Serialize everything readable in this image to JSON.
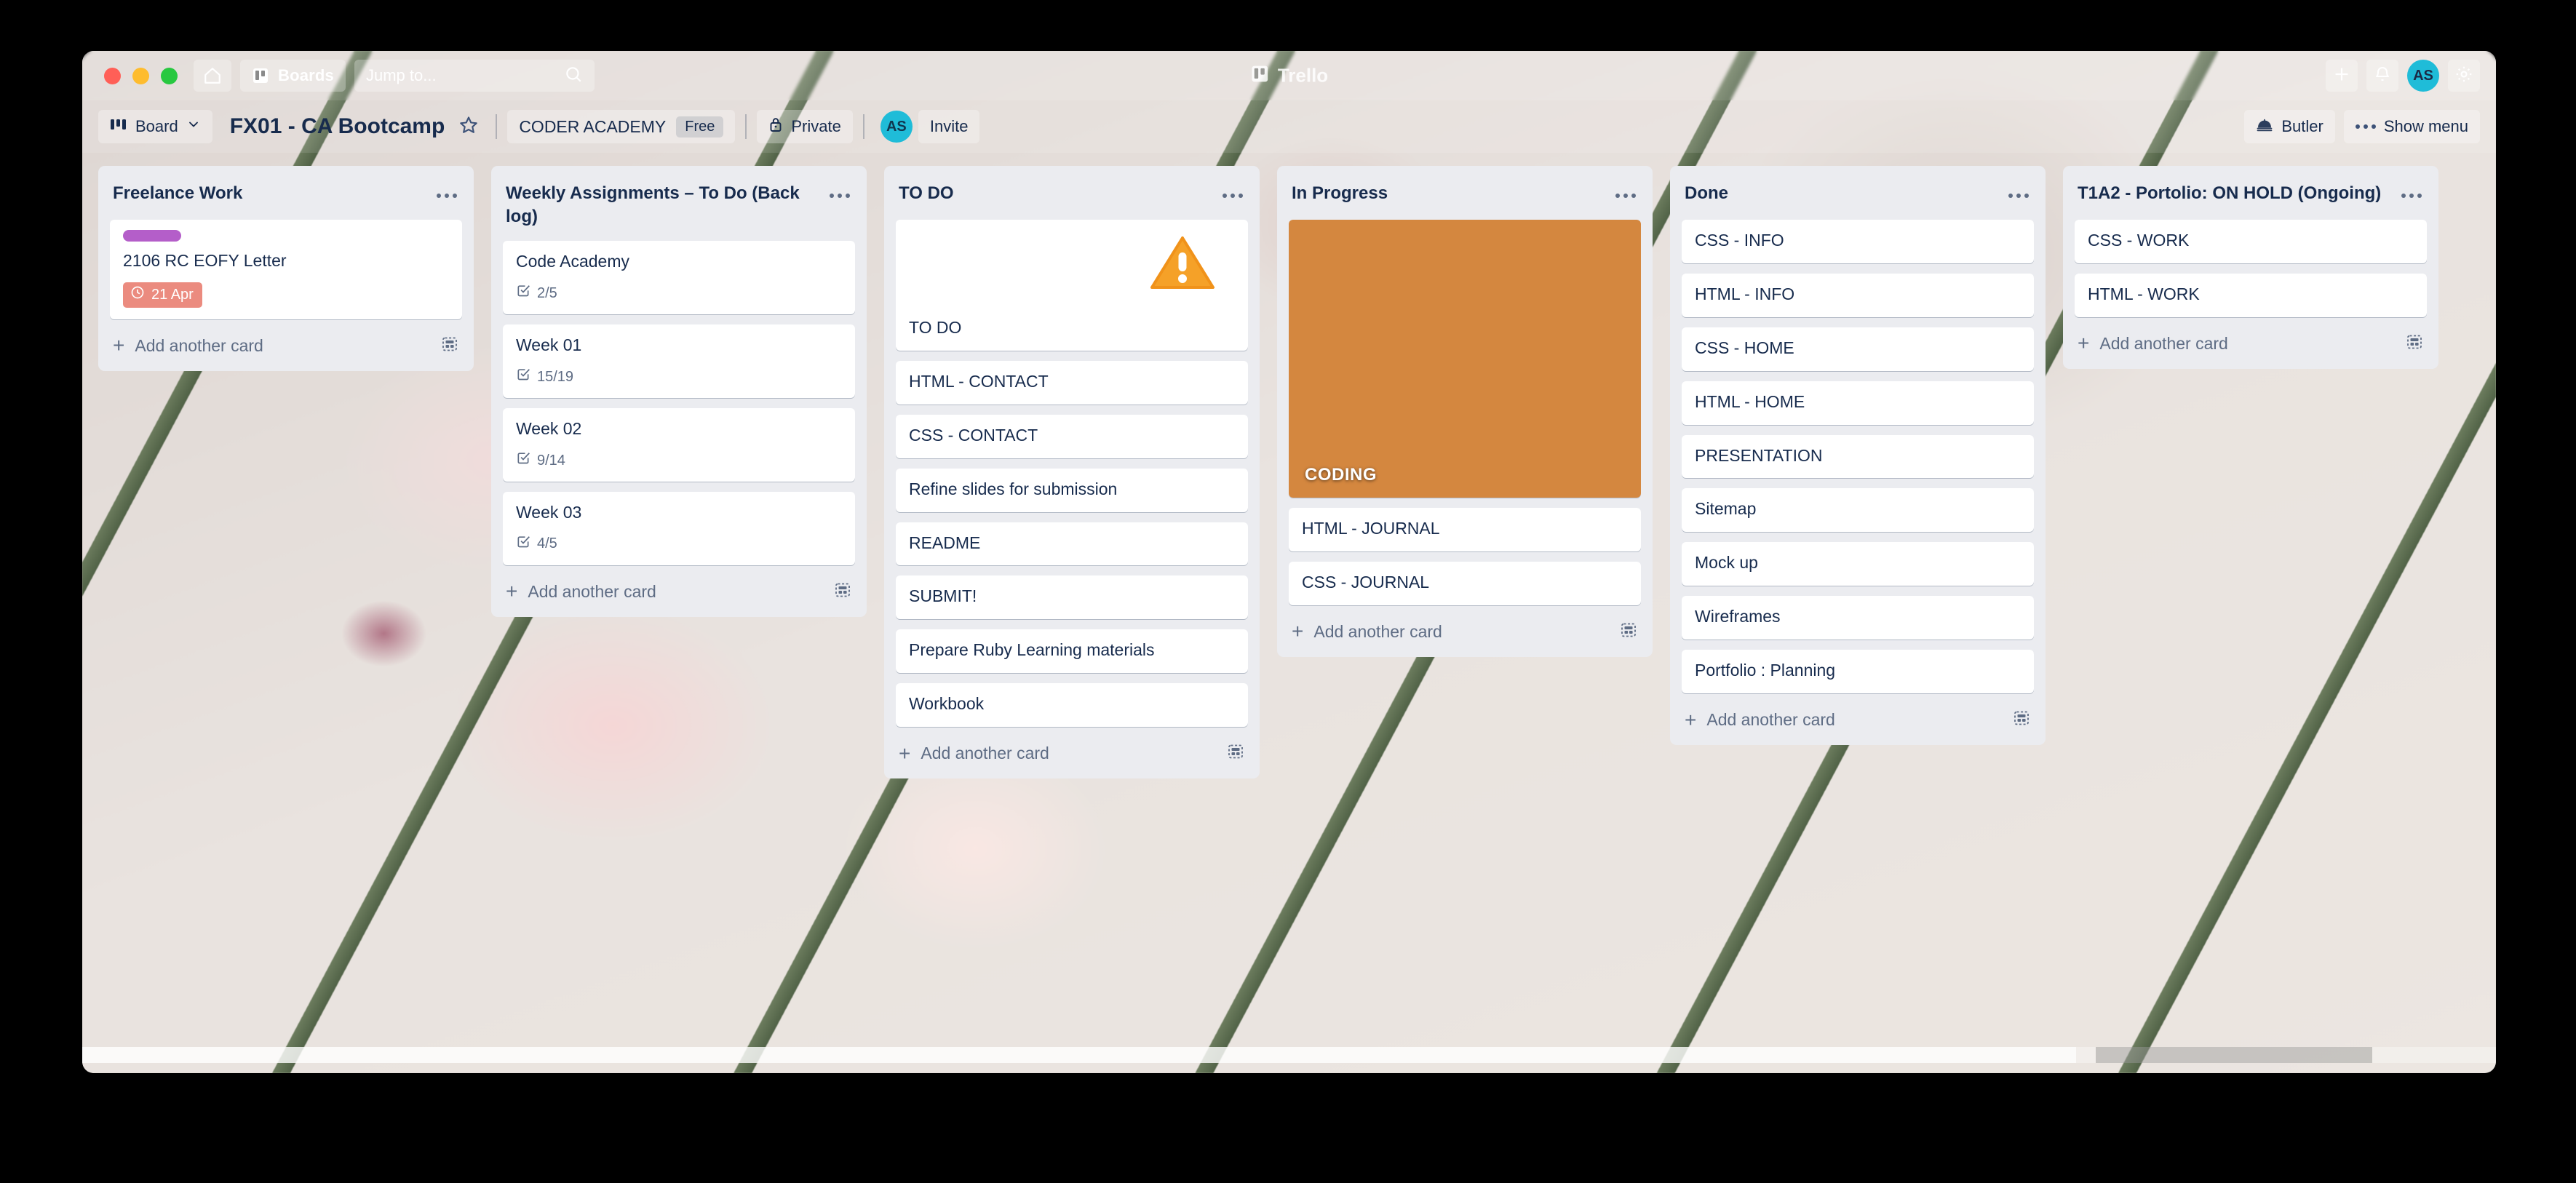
{
  "window": {
    "traffic_lights": [
      "close",
      "minimize",
      "zoom"
    ]
  },
  "topnav": {
    "home_icon": "home-icon",
    "boards_label": "Boards",
    "boards_icon": "trello-board-icon",
    "jump_to_placeholder": "Jump to...",
    "search_icon": "search-icon",
    "brand_label": "Trello",
    "brand_icon": "trello-logo-icon",
    "add_icon": "plus-icon",
    "notifications_icon": "bell-icon",
    "avatar_initials": "AS",
    "settings_icon": "gear-icon"
  },
  "boardbar": {
    "view_label": "Board",
    "view_icon": "board-view-icon",
    "view_chevron_icon": "chevron-down-icon",
    "board_title": "FX01 - CA Bootcamp",
    "star_icon": "star-icon",
    "team_name": "CODER ACADEMY",
    "plan_badge": "Free",
    "visibility_label": "Private",
    "visibility_icon": "lock-icon",
    "member_initials": "AS",
    "invite_label": "Invite",
    "butler_label": "Butler",
    "butler_icon": "butler-icon",
    "show_menu_label": "Show menu",
    "show_menu_icon": "ellipsis-icon"
  },
  "colors": {
    "label_purple": "#b45ec9",
    "due_red": "#eb8b7f",
    "avatar_teal": "#1fbcd8",
    "list_bg": "#ebecf0",
    "text_dark": "#172b4d",
    "text_muted": "#5e6c84"
  },
  "common": {
    "add_card_label": "Add another card",
    "add_icon": "plus-icon",
    "template_icon": "card-template-icon",
    "list_menu_icon": "ellipsis-icon"
  },
  "lists": [
    {
      "title": "Freelance Work",
      "cards": [
        {
          "title": "2106 RC EOFY Letter",
          "label_color": "#b45ec9",
          "due_date": "21 Apr",
          "due_icon": "clock-icon"
        }
      ]
    },
    {
      "title": "Weekly Assignments – To Do (Back log)",
      "cards": [
        {
          "title": "Code Academy",
          "checklist": "2/5",
          "checklist_icon": "checklist-icon"
        },
        {
          "title": "Week 01",
          "checklist": "15/19",
          "checklist_icon": "checklist-icon"
        },
        {
          "title": "Week 02",
          "checklist": "9/14",
          "checklist_icon": "checklist-icon"
        },
        {
          "title": "Week 03",
          "checklist": "4/5",
          "checklist_icon": "checklist-icon"
        }
      ]
    },
    {
      "title": "TO DO",
      "cards": [
        {
          "title": "TO DO",
          "cover": "warning-triangle-icon"
        },
        {
          "title": "HTML - CONTACT"
        },
        {
          "title": "CSS - CONTACT"
        },
        {
          "title": "Refine slides for submission"
        },
        {
          "title": "README"
        },
        {
          "title": "SUBMIT!"
        },
        {
          "title": "Prepare Ruby Learning materials"
        },
        {
          "title": "Workbook"
        }
      ]
    },
    {
      "title": "In Progress",
      "cards": [
        {
          "title": "CODING",
          "cover": "cat-photo"
        },
        {
          "title": "HTML - JOURNAL"
        },
        {
          "title": "CSS - JOURNAL"
        }
      ]
    },
    {
      "title": "Done",
      "cards": [
        {
          "title": "CSS - INFO"
        },
        {
          "title": "HTML - INFO"
        },
        {
          "title": "CSS - HOME"
        },
        {
          "title": "HTML - HOME"
        },
        {
          "title": "PRESENTATION"
        },
        {
          "title": "Sitemap"
        },
        {
          "title": "Mock up"
        },
        {
          "title": "Wireframes"
        },
        {
          "title": "Portfolio : Planning"
        }
      ]
    },
    {
      "title": "T1A2 - Portolio: ON HOLD (Ongoing)",
      "cards": [
        {
          "title": "CSS - WORK"
        },
        {
          "title": "HTML - WORK"
        }
      ]
    }
  ]
}
